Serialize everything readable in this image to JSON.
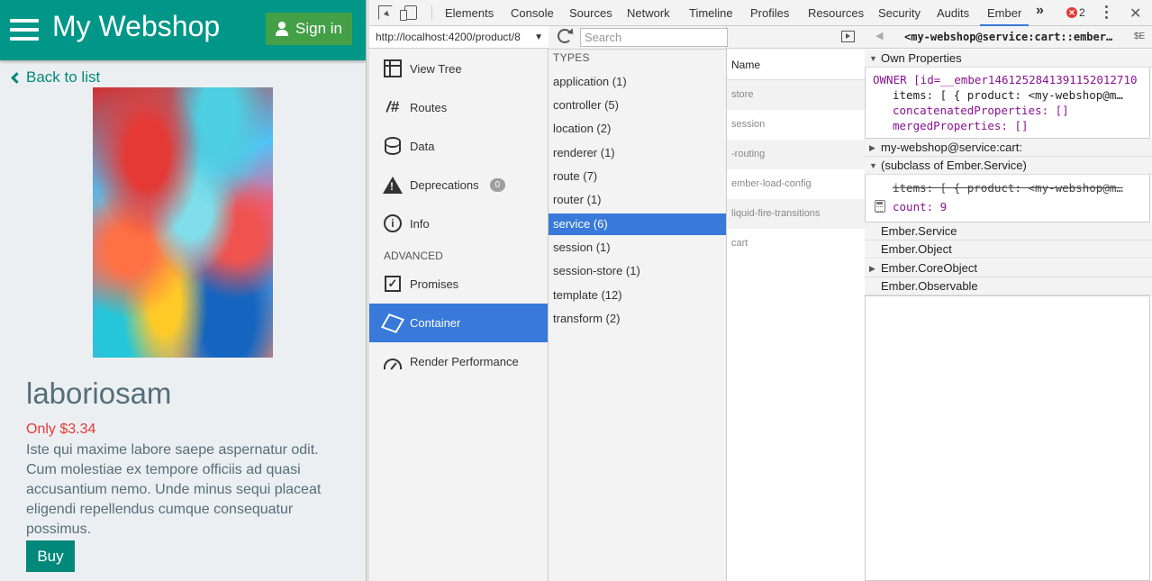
{
  "shop": {
    "title": "My Webshop",
    "sign_in": "Sign in",
    "back": "Back to list",
    "product_name": "laboriosam",
    "price": "Only $3.34",
    "description": "Iste qui maxime labore saepe aspernatur odit. Cum molestiae ex tempore officiis ad quasi accusantium nemo. Unde minus sequi placeat eligendi repellendus cumque consequatur possimus.",
    "buy": "Buy"
  },
  "devtools": {
    "tabs": [
      "Elements",
      "Console",
      "Sources",
      "Network",
      "Timeline",
      "Profiles",
      "Resources",
      "Security",
      "Audits",
      "Ember"
    ],
    "active_tab": "Ember",
    "more": "»",
    "error_count": "2",
    "close": "✕"
  },
  "ember": {
    "url": "http://localhost:4200/product/8",
    "nav": [
      {
        "label": "View Tree",
        "icon": "view-tree-icon"
      },
      {
        "label": "Routes",
        "icon": "routes-icon",
        "glyph": "/#"
      },
      {
        "label": "Data",
        "icon": "data-icon"
      },
      {
        "label": "Deprecations",
        "icon": "warning-icon",
        "badge": "0"
      },
      {
        "label": "Info",
        "icon": "info-icon",
        "glyph": "i"
      }
    ],
    "advanced_label": "ADVANCED",
    "advanced_nav": [
      {
        "label": "Promises",
        "icon": "promises-icon",
        "glyph": "✓"
      },
      {
        "label": "Container",
        "icon": "container-icon",
        "selected": true
      },
      {
        "label": "Render Performance",
        "icon": "render-performance-icon"
      }
    ],
    "search_placeholder": "Search",
    "types_label": "TYPES",
    "types": [
      "application (1)",
      "controller (5)",
      "location (2)",
      "renderer (1)",
      "route (7)",
      "router (1)",
      "service (6)",
      "session (1)",
      "session-store (1)",
      "template (12)",
      "transform (2)"
    ],
    "selected_type": "service (6)",
    "names_header": "Name",
    "names": [
      "store",
      "session",
      "-routing",
      "ember-load-config",
      "liquid-fire-transitions",
      "cart"
    ],
    "inspector": {
      "back": "◀",
      "title": "<my-webshop@service:cart::ember…",
      "send_to_console": "$E",
      "sections": {
        "own": "Own Properties",
        "cart": "my-webshop@service:cart:",
        "subclass": "(subclass of Ember.Service)",
        "service": "Ember.Service",
        "object": "Ember.Object",
        "core": "Ember.CoreObject",
        "observable": "Ember.Observable"
      },
      "own_props": {
        "owner": "OWNER [id=__ember1461252841391152012710",
        "items": "items: [ { product: <my-webshop@m…",
        "concat": "concatenatedProperties: []",
        "merged": "mergedProperties: []"
      },
      "sub_props": {
        "items": "items: [ { product: <my-webshop@m…",
        "count": "count: 9"
      }
    }
  }
}
